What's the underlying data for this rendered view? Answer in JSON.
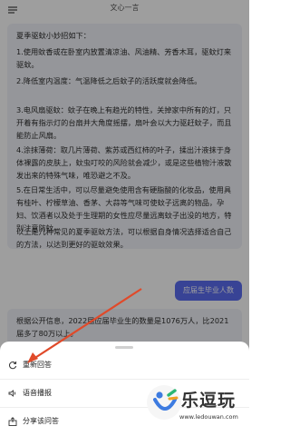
{
  "header": {
    "title": "文心一言"
  },
  "reply": {
    "intro": "夏季驱蚊小妙招如下：",
    "tips": [
      "1.使用蚊香或在卧室内放置清凉油、风油精、芳香木耳，驱蚊灯来驱蚊。",
      "2.降低室内温度：气温降低之后蚊子的活跃度就会降低。",
      "3.电风扇驱蚊：蚊子在晚上有趋光的特性，关掉家中所有的灯，只开着有指示灯的台扇并大角度摇摆，扇叶会以大力驱赶蚊子，而且能防止风扇。",
      "4.涂抹薄荷：取几片薄荷、紫苏或西红柿的叶子，揉出汁液抹于身体裸露的皮肤上，蚊虫叮咬的风险就会减少，或是这些植物汁液散发出来的特殊气味，唯恐避之不及。",
      "5.在日常生活中，可以尽量避免使用含有硬脂酸的化妆品，使用具有桂叶、柠檬草油、香茅、大蒜等气味可使蚊子远离的物品，孕妇、饮酒者以及处于生理期的女性应尽量远离蚊子出没的地方，特别注意防蚊。"
    ],
    "outro": "以上是几种常见的夏季驱蚊方法，可以根据自身情况选择适合自己的方法，以达到更好的驱蚊效果。"
  },
  "user_message": "应届生毕业人数",
  "reply2": {
    "text": "根据公开信息，2022届应届毕业生的数量是1076万人，比2021届多了80万以上。"
  },
  "sheet": {
    "items": [
      {
        "label": "重新回答",
        "icon": "refresh-icon"
      },
      {
        "label": "语音播报",
        "icon": "speaker-icon"
      },
      {
        "label": "分享该问答",
        "icon": "share-icon"
      }
    ]
  },
  "annotation": {
    "color": "#e04a2a"
  },
  "watermark": {
    "title": "乐逗玩",
    "url": "www.ledouwan.com"
  }
}
